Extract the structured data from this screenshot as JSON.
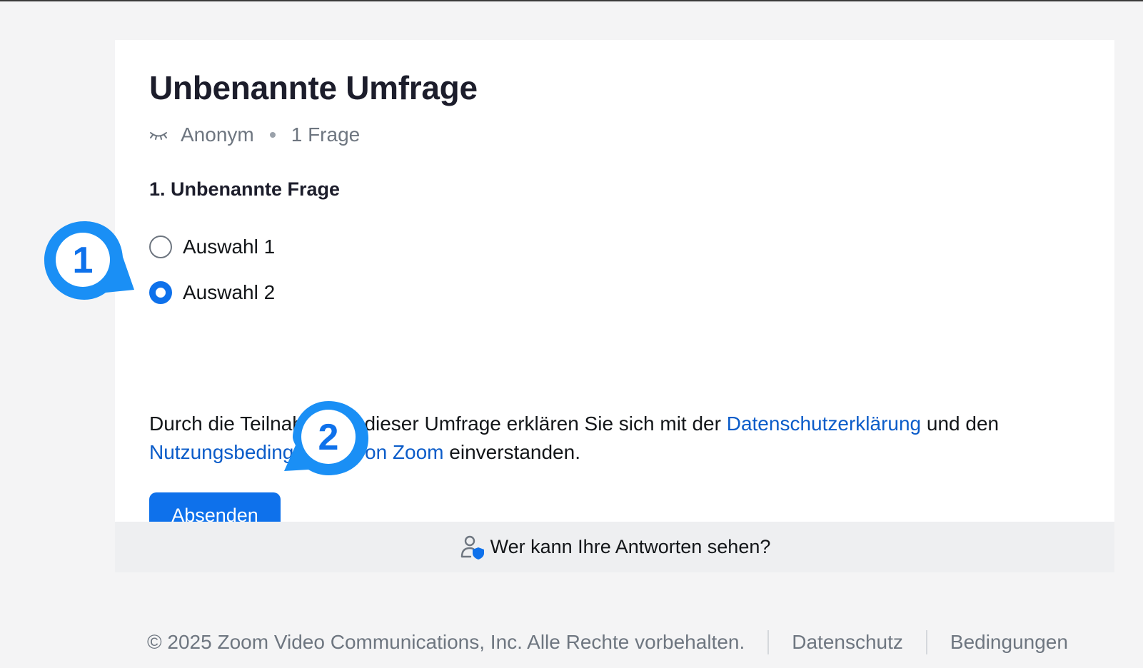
{
  "survey": {
    "title": "Unbenannte Umfrage",
    "anonymous_label": "Anonym",
    "question_count": "1 Frage",
    "question": "1. Unbenannte Frage",
    "choices": [
      {
        "label": "Auswahl 1",
        "selected": false
      },
      {
        "label": "Auswahl 2",
        "selected": true
      }
    ],
    "consent": {
      "text_before": "Durch die Teilnahme an dieser Umfrage erklären Sie sich mit der ",
      "privacy_link": "Datenschutzerklärung",
      "text_middle": " und den ",
      "terms_link": "Nutzungsbedingungen von Zoom",
      "text_after": " einverstanden."
    },
    "submit_label": "Absenden",
    "visibility_label": "Wer kann Ihre Antworten sehen?"
  },
  "footer": {
    "copyright": "© 2025 Zoom Video Communications, Inc. Alle Rechte vorbehalten.",
    "privacy": "Datenschutz",
    "terms": "Bedingungen"
  },
  "annotations": [
    {
      "number": "1"
    },
    {
      "number": "2"
    }
  ],
  "colors": {
    "accent": "#0e71eb",
    "link": "#0b5cc9",
    "badge": "#1a8ff5"
  }
}
